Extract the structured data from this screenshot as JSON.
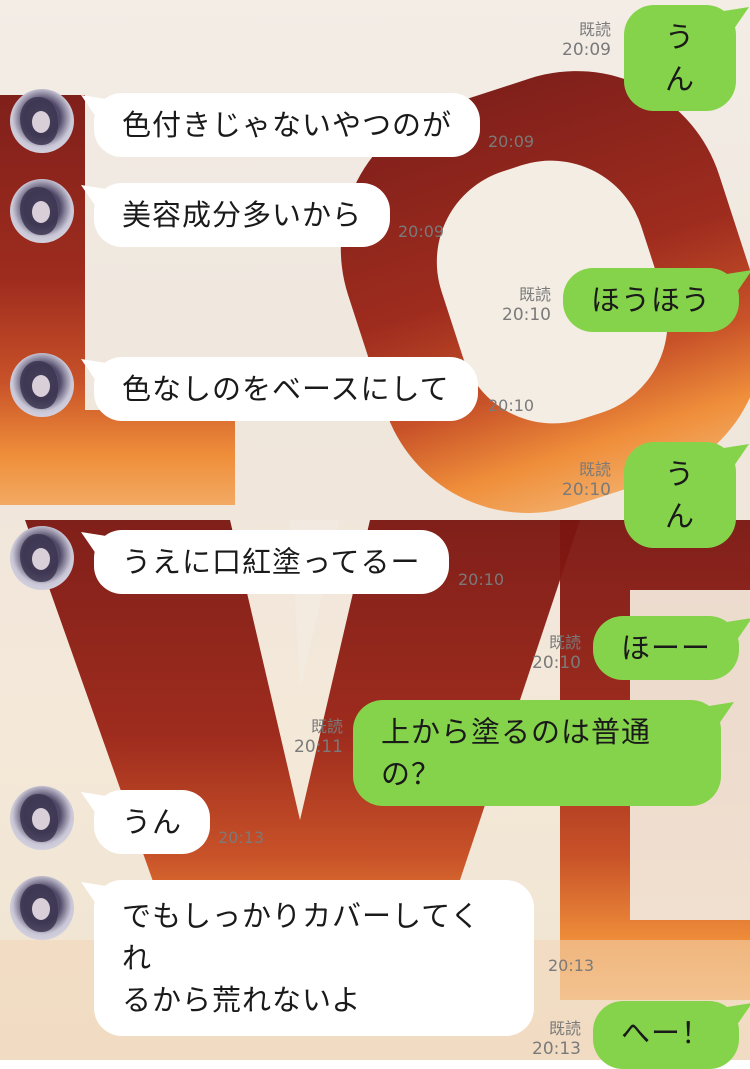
{
  "conversation": {
    "messages": [
      {
        "direction": "out",
        "text": "うん",
        "read": "既読",
        "time": "20:09"
      },
      {
        "direction": "in",
        "text": "色付きじゃないやつのが",
        "time": "20:09"
      },
      {
        "direction": "in",
        "text": "美容成分多いから",
        "time": "20:09"
      },
      {
        "direction": "out",
        "text": "ほうほう",
        "read": "既読",
        "time": "20:10"
      },
      {
        "direction": "in",
        "text": "色なしのをベースにして",
        "time": "20:10"
      },
      {
        "direction": "out",
        "text": "うん",
        "read": "既読",
        "time": "20:10"
      },
      {
        "direction": "in",
        "text": "うえに口紅塗ってるー",
        "time": "20:10"
      },
      {
        "direction": "out",
        "text": "ほーー",
        "read": "既読",
        "time": "20:10"
      },
      {
        "direction": "out",
        "text": "上から塗るのは普通の？",
        "read": "既読",
        "time": "20:11"
      },
      {
        "direction": "in",
        "text": "うん",
        "time": "20:13"
      },
      {
        "direction": "in",
        "text": "でもしっかりカバーしてくれ\nるから荒れないよ",
        "time": "20:13"
      },
      {
        "direction": "out",
        "text": "へー！",
        "read": "既読",
        "time": "20:13"
      }
    ]
  },
  "theme": {
    "out_bubble_color": "#85d34a",
    "in_bubble_color": "#ffffff",
    "background_art_colors": [
      "#8b1a12",
      "#c4331d",
      "#ec7a2a"
    ]
  },
  "icons": {
    "avatar": "avatar-icon"
  }
}
